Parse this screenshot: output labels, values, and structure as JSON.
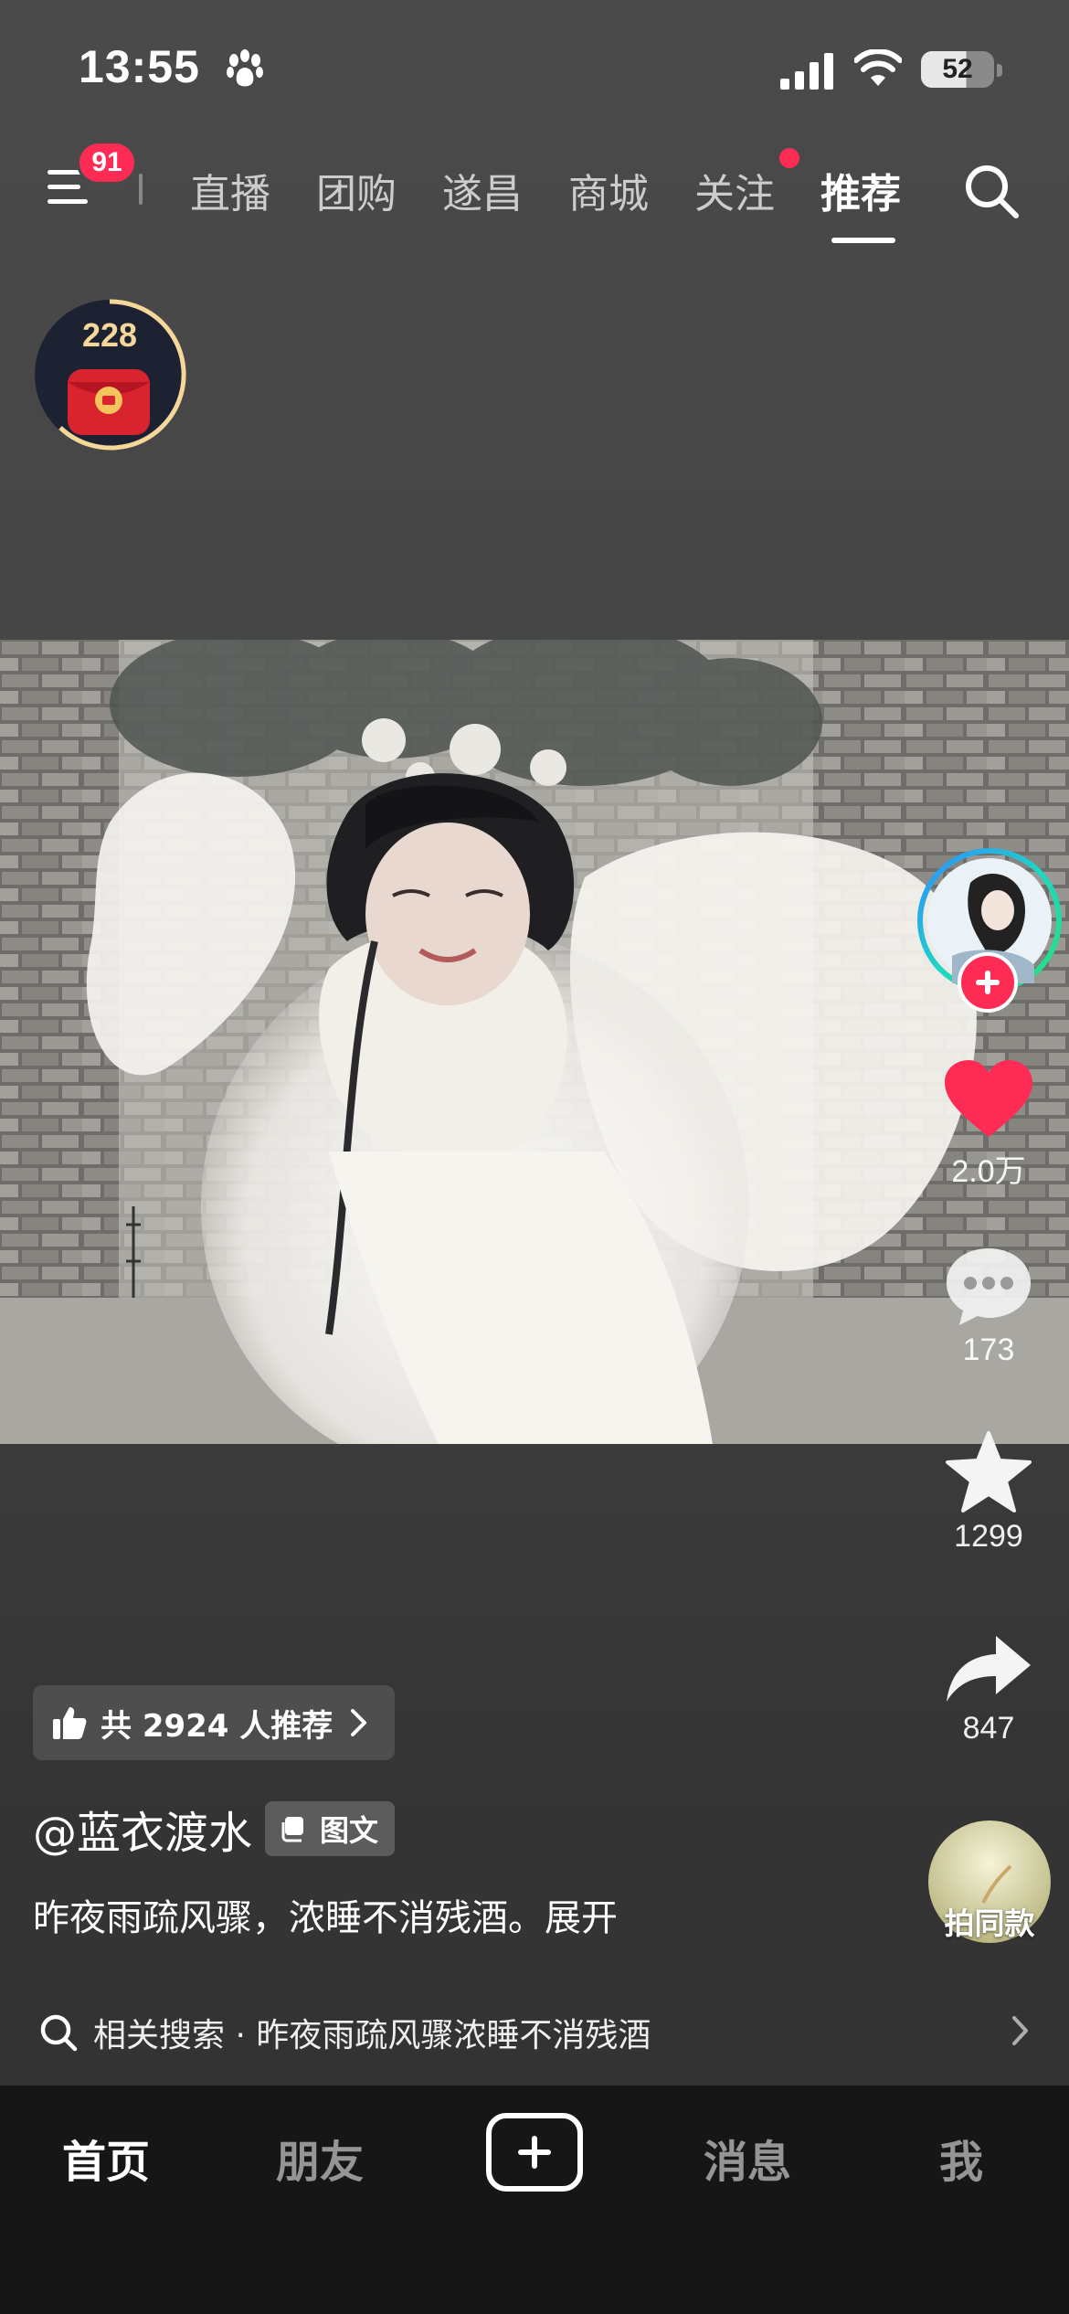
{
  "status_bar": {
    "time": "13:55",
    "battery": "52"
  },
  "top_nav": {
    "menu_badge": "91",
    "tabs": [
      {
        "label": "直播"
      },
      {
        "label": "团购"
      },
      {
        "label": "遂昌"
      },
      {
        "label": "商城"
      },
      {
        "label": "关注"
      },
      {
        "label": "推荐"
      }
    ],
    "active_tab": "推荐"
  },
  "red_packet": {
    "count": "228"
  },
  "actions": {
    "likes": "2.0万",
    "comments": "173",
    "favorites": "1299",
    "shares": "847",
    "remix_label": "拍同款"
  },
  "post": {
    "recommend_text": "共 2924 人推荐",
    "author": "@蓝衣渡水",
    "type_badge": "图文",
    "caption": "昨夜雨疏风骤，浓睡不消残酒。展开",
    "related_search": "相关搜索 · 昨夜雨疏风骤浓睡不消残酒"
  },
  "bottom_bar": {
    "tabs": [
      {
        "label": "首页"
      },
      {
        "label": "朋友"
      },
      {
        "label": "消息"
      },
      {
        "label": "我"
      }
    ]
  },
  "colors": {
    "accent": "#fe2c55",
    "background": "#454545",
    "bottom_bar": "#161616"
  }
}
